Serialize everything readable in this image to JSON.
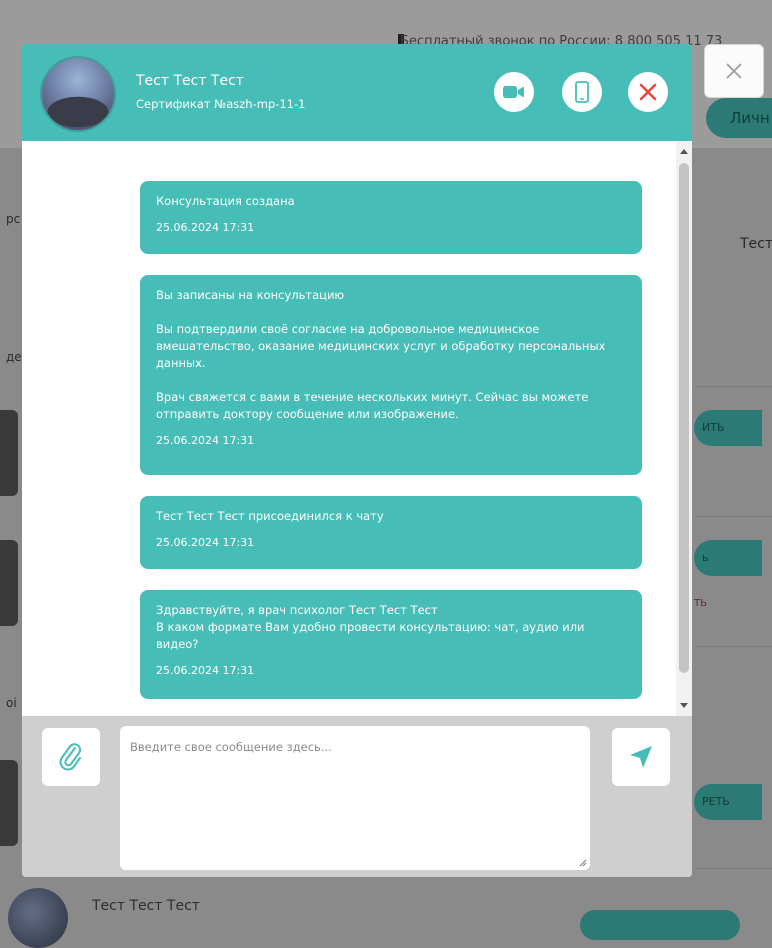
{
  "background": {
    "phone_line": "Бесплатный звонок по России: 8 800 505 11 73",
    "lk_button": "Личн",
    "right_name_fragment": "Тест",
    "left_fragments": [
      "рс",
      "де",
      "оі"
    ],
    "pill_labels": [
      "ИТЬ",
      "ь",
      "ТЬ",
      "РЕТЬ"
    ],
    "bottom_name": "Тест Тест Тест"
  },
  "chat": {
    "doctor_name": "Тест Тест Тест",
    "certificate": "Сертификат №aszh-mp-11-1",
    "actions": {
      "video_icon": "video-camera-icon",
      "phone_icon": "mobile-phone-icon",
      "close_icon": "close-x-icon"
    },
    "messages": [
      {
        "lines": [
          "Консультация создана"
        ],
        "time": "25.06.2024 17:31"
      },
      {
        "paragraphs": [
          "Вы записаны на консультацию",
          "Вы подтвердили своё согласие на добровольное медицинское вмешательство, оказание медицинских услуг и обработку персональных данных.",
          "Врач свяжется с вами в течение нескольких минут. Сейчас вы можете отправить доктору сообщение или изображение."
        ],
        "time": "25.06.2024 17:31"
      },
      {
        "lines": [
          "Тест Тест Тест  присоединился к чату"
        ],
        "time": "25.06.2024 17:31"
      },
      {
        "lines": [
          "Здравствуйте, я врач психолог  Тест Тест Тест",
          "В каком формате Вам удобно провести консультацию: чат, аудио или видео?"
        ],
        "time": "25.06.2024 17:31"
      }
    ],
    "composer": {
      "placeholder": "Введите свое сообщение здесь...",
      "value": "",
      "attach_icon": "paperclip-icon",
      "send_icon": "send-arrow-icon"
    }
  },
  "colors": {
    "accent": "#47bdb7",
    "overlay_accent": "#2c7a76",
    "close_red": "#e8473f"
  }
}
